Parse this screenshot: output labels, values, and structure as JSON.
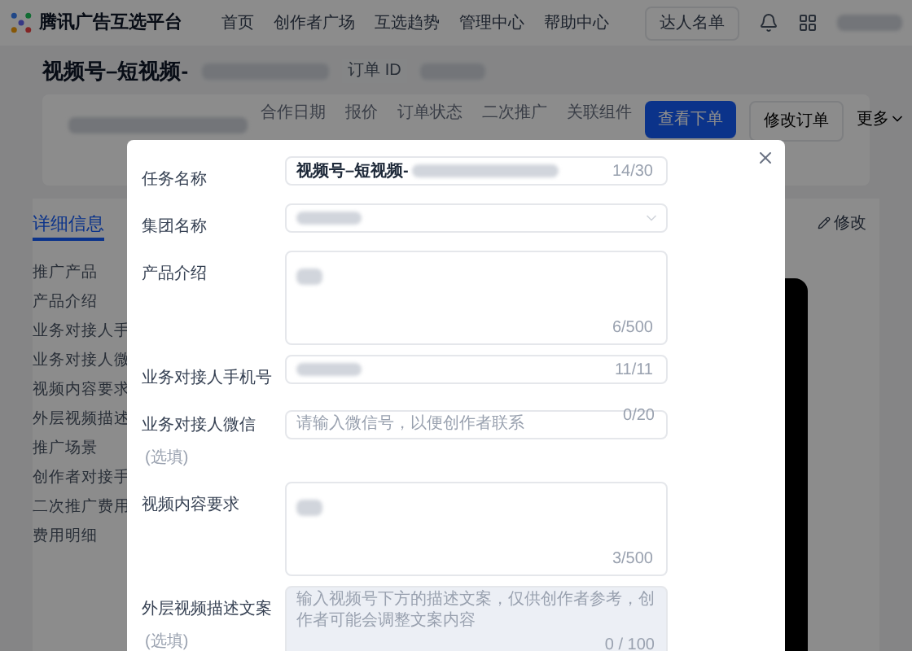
{
  "nav": {
    "logo": "腾讯广告互选平台",
    "items": [
      {
        "label": "首页",
        "selected": false
      },
      {
        "label": "创作者广场",
        "selected": false
      },
      {
        "label": "互选趋势",
        "selected": false
      },
      {
        "label": "管理中心",
        "selected": false
      },
      {
        "label": "帮助中心",
        "selected": false
      }
    ],
    "button": "达人名单"
  },
  "header": {
    "title": "视频号–短视频-",
    "order_id_label": "订单 ID"
  },
  "order_card": {
    "columns": [
      "合作日期",
      "报价",
      "订单状态",
      "二次推广",
      "关联组件"
    ],
    "primary_button": "查看下单",
    "secondary_button": "修改订单",
    "more": "更多"
  },
  "detail": {
    "tab": "详细信息",
    "edit": "修改",
    "sidebar_items": [
      "推广产品",
      "产品介绍",
      "业务对接人手",
      "业务对接人微",
      "视频内容要求",
      "外层视频描述",
      "推广场景",
      "创作者对接手",
      "二次推广费用",
      "费用明细"
    ]
  },
  "modal": {
    "fields": [
      {
        "kind": "input",
        "label": "任务名称",
        "value": "视频号–短视频-",
        "redacted": true,
        "counter": "14/30"
      },
      {
        "kind": "select",
        "label": "集团名称",
        "redacted": true
      },
      {
        "kind": "textarea",
        "label": "产品介绍",
        "redacted": true,
        "counter": "6/500"
      },
      {
        "kind": "input",
        "label": "业务对接人手机号",
        "redacted": true,
        "counter": "11/11"
      },
      {
        "kind": "input",
        "label": "业务对接人微信",
        "optional": "(选填)",
        "placeholder": "请输入微信号，以便创作者联系",
        "counter": "0/20"
      },
      {
        "kind": "textarea",
        "label": "视频内容要求",
        "redacted": true,
        "counter": "3/500"
      },
      {
        "kind": "textarea",
        "label": "外层视频描述文案",
        "optional": "(选填)",
        "placeholder": "输入视频号下方的描述文案，仅供创作者参考，创作者可能会调整文案内容",
        "counter": "0 / 100",
        "tinted": true
      }
    ]
  }
}
